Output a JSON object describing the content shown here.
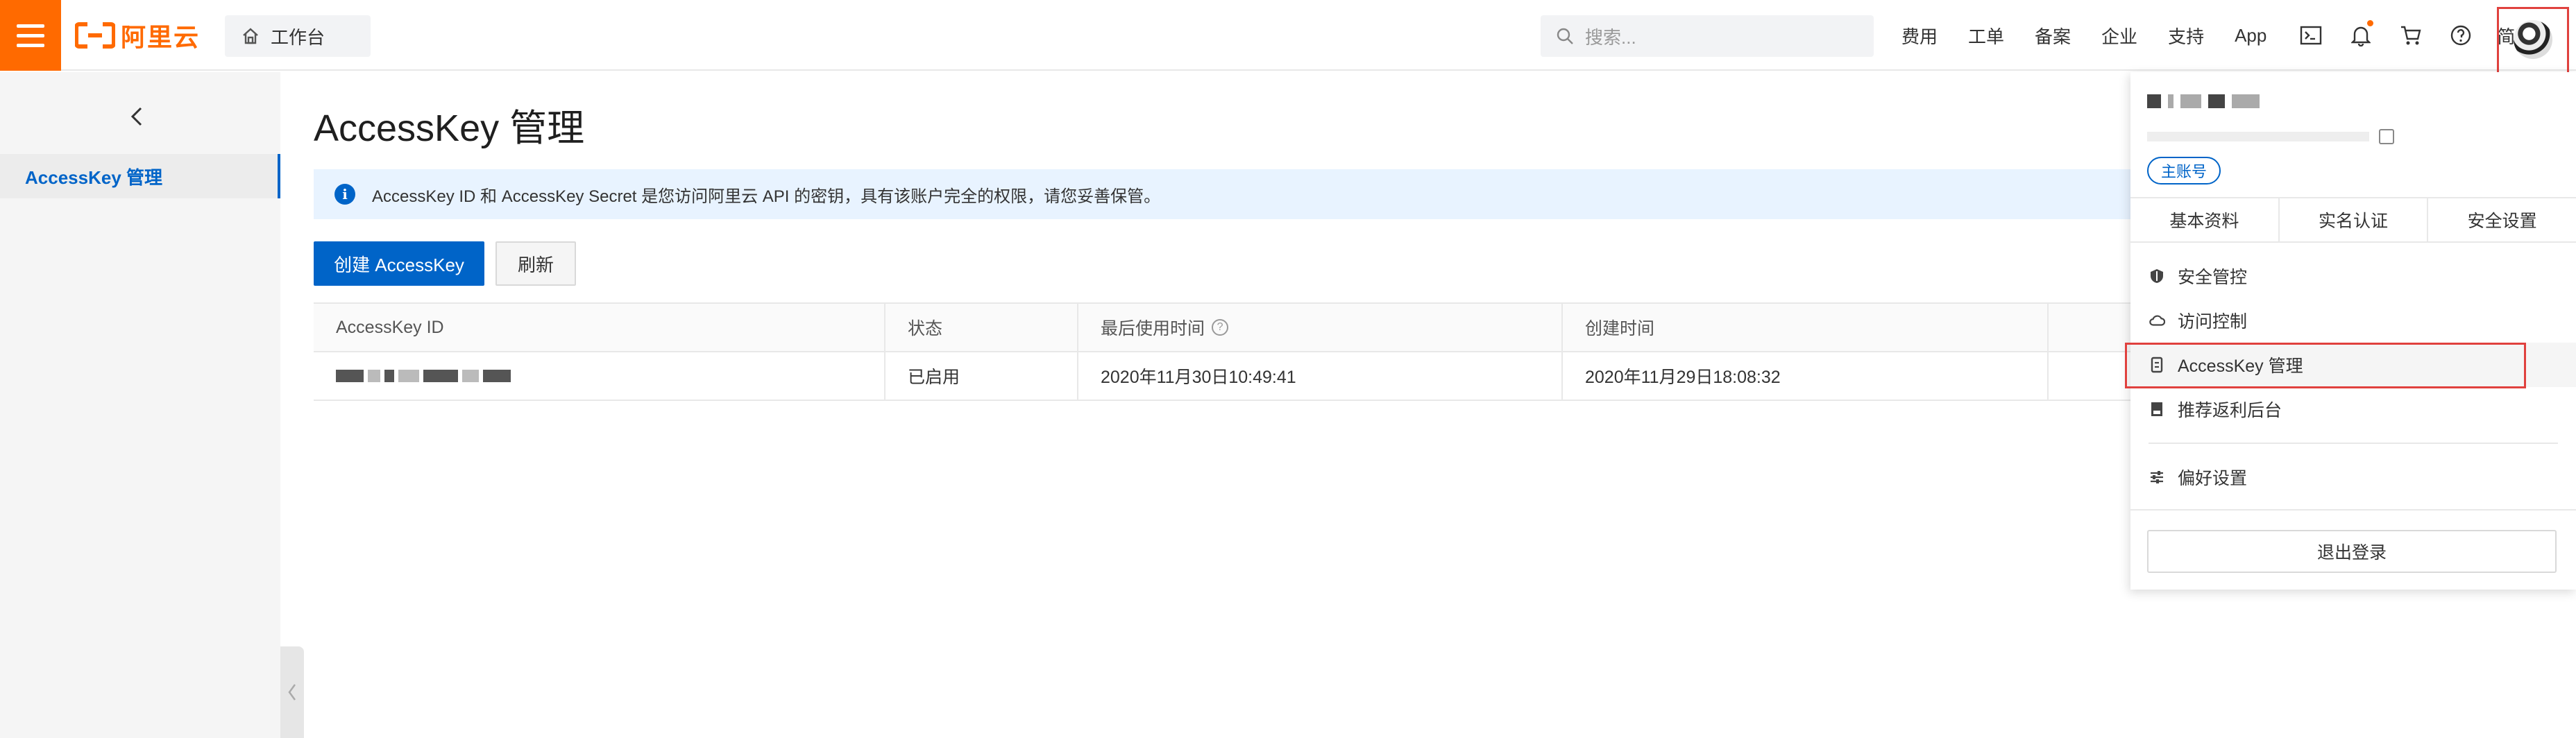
{
  "topbar": {
    "logo_text": "阿里云",
    "workbench_label": "工作台",
    "search_placeholder": "搜索...",
    "nav_items": [
      "费用",
      "工单",
      "备案",
      "企业",
      "支持",
      "App"
    ],
    "language": "简体",
    "brand_color": "#ff6a00",
    "icons": [
      "terminal-icon",
      "bell-icon",
      "cart-icon",
      "help-icon"
    ]
  },
  "sidebar": {
    "items": [
      {
        "label": "AccessKey 管理",
        "active": true
      }
    ]
  },
  "main": {
    "title": "AccessKey 管理",
    "notice": "AccessKey ID 和 AccessKey Secret 是您访问阿里云 API 的密钥，具有该账户完全的权限，请您妥善保管。",
    "buttons": {
      "create": "创建 AccessKey",
      "refresh": "刷新"
    },
    "table": {
      "columns": [
        "AccessKey ID",
        "状态",
        "最后使用时间",
        "创建时间",
        ""
      ],
      "rows": [
        {
          "status": "已启用",
          "last_used": "2020年11月30日10:49:41",
          "created": "2020年11月29日18:08:32"
        }
      ]
    }
  },
  "dropdown": {
    "badge": "主账号",
    "tabs": [
      "基本资料",
      "实名认证",
      "安全设置"
    ],
    "menu": [
      {
        "label": "安全管控",
        "icon": "shield-icon"
      },
      {
        "label": "访问控制",
        "icon": "cloud-icon"
      },
      {
        "label": "AccessKey 管理",
        "icon": "key-icon",
        "active": true
      },
      {
        "label": "推荐返利后台",
        "icon": "bookmark-icon"
      }
    ],
    "preferences": {
      "label": "偏好设置",
      "icon": "sliders-icon"
    },
    "logout": "退出登录"
  },
  "colors": {
    "primary": "#0064c8",
    "notice_bg": "#e8f3ff",
    "highlight": "#e0413e"
  }
}
